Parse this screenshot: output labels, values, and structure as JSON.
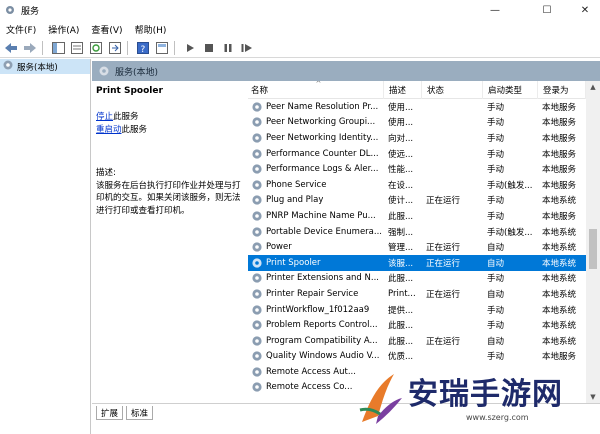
{
  "window": {
    "title": "服务"
  },
  "window_controls": {
    "minimize": "—",
    "maximize": "☐",
    "close": "✕"
  },
  "menu": [
    "文件(F)",
    "操作(A)",
    "查看(V)",
    "帮助(H)"
  ],
  "tree": {
    "item": "服务(本地)"
  },
  "main_header": {
    "label": "服务(本地)"
  },
  "desc": {
    "service_name": "Print Spooler",
    "stop_link": "停止",
    "stop_suffix": "此服务",
    "restart_link": "重启动",
    "restart_suffix": "此服务",
    "label": "描述:",
    "text": "该服务在后台执行打印作业并处理与打印机的交互。如果关闭该服务，则无法进行打印或查看打印机。"
  },
  "columns": [
    "名称",
    "描述",
    "状态",
    "启动类型",
    "登录为"
  ],
  "rows": [
    {
      "name": "Peer Name Resolution Pr...",
      "desc": "使用...",
      "status": "",
      "start": "手动",
      "logon": "本地服务"
    },
    {
      "name": "Peer Networking Groupi...",
      "desc": "使用...",
      "status": "",
      "start": "手动",
      "logon": "本地服务"
    },
    {
      "name": "Peer Networking Identity...",
      "desc": "向对...",
      "status": "",
      "start": "手动",
      "logon": "本地服务"
    },
    {
      "name": "Performance Counter DL...",
      "desc": "使远...",
      "status": "",
      "start": "手动",
      "logon": "本地服务"
    },
    {
      "name": "Performance Logs & Aler...",
      "desc": "性能...",
      "status": "",
      "start": "手动",
      "logon": "本地服务"
    },
    {
      "name": "Phone Service",
      "desc": "在设...",
      "status": "",
      "start": "手动(触发...",
      "logon": "本地服务"
    },
    {
      "name": "Plug and Play",
      "desc": "使计...",
      "status": "正在运行",
      "start": "手动",
      "logon": "本地系统"
    },
    {
      "name": "PNRP Machine Name Pu...",
      "desc": "此服...",
      "status": "",
      "start": "手动",
      "logon": "本地服务"
    },
    {
      "name": "Portable Device Enumera...",
      "desc": "强制...",
      "status": "",
      "start": "手动(触发...",
      "logon": "本地系统"
    },
    {
      "name": "Power",
      "desc": "管理...",
      "status": "正在运行",
      "start": "自动",
      "logon": "本地系统"
    },
    {
      "name": "Print Spooler",
      "desc": "该服...",
      "status": "正在运行",
      "start": "自动",
      "logon": "本地系统",
      "selected": true
    },
    {
      "name": "Printer Extensions and N...",
      "desc": "此服...",
      "status": "",
      "start": "手动",
      "logon": "本地系统"
    },
    {
      "name": "Printer Repair Service",
      "desc": "Print...",
      "status": "正在运行",
      "start": "自动",
      "logon": "本地系统"
    },
    {
      "name": "PrintWorkflow_1f012aa9",
      "desc": "提供...",
      "status": "",
      "start": "手动",
      "logon": "本地系统"
    },
    {
      "name": "Problem Reports Control...",
      "desc": "此服...",
      "status": "",
      "start": "手动",
      "logon": "本地系统"
    },
    {
      "name": "Program Compatibility A...",
      "desc": "此服...",
      "status": "正在运行",
      "start": "自动",
      "logon": "本地系统"
    },
    {
      "name": "Quality Windows Audio V...",
      "desc": "优质...",
      "status": "",
      "start": "手动",
      "logon": "本地服务"
    },
    {
      "name": "Remote Access Aut...",
      "desc": "",
      "status": "",
      "start": "",
      "logon": ""
    },
    {
      "name": "Remote Access Co...",
      "desc": "",
      "status": "",
      "start": "",
      "logon": ""
    }
  ],
  "tabs": [
    "扩展",
    "标准"
  ],
  "branding": {
    "title": "安瑞手游网",
    "url": "www.szerg.com"
  },
  "colors": {
    "selection": "#0078d7",
    "header_bar": "#9aadbf",
    "link": "#0033cc"
  }
}
